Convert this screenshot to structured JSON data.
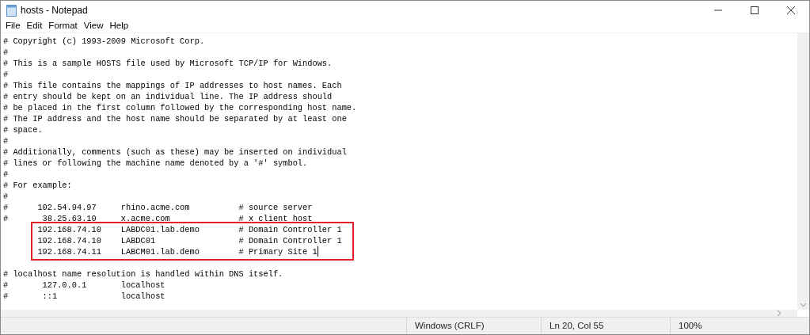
{
  "window": {
    "title": "hosts - Notepad"
  },
  "menu": [
    "File",
    "Edit",
    "Format",
    "View",
    "Help"
  ],
  "lines": [
    {
      "kind": "text",
      "text": "# Copyright (c) 1993-2009 Microsoft Corp.",
      "highlighted": false,
      "caret": false
    },
    {
      "kind": "text",
      "text": "#",
      "highlighted": false,
      "caret": false
    },
    {
      "kind": "text",
      "text": "# This is a sample HOSTS file used by Microsoft TCP/IP for Windows.",
      "highlighted": false,
      "caret": false
    },
    {
      "kind": "text",
      "text": "#",
      "highlighted": false,
      "caret": false
    },
    {
      "kind": "text",
      "text": "# This file contains the mappings of IP addresses to host names. Each",
      "highlighted": false,
      "caret": false
    },
    {
      "kind": "text",
      "text": "# entry should be kept on an individual line. The IP address should",
      "highlighted": false,
      "caret": false
    },
    {
      "kind": "text",
      "text": "# be placed in the first column followed by the corresponding host name.",
      "highlighted": false,
      "caret": false
    },
    {
      "kind": "text",
      "text": "# The IP address and the host name should be separated by at least one",
      "highlighted": false,
      "caret": false
    },
    {
      "kind": "text",
      "text": "# space.",
      "highlighted": false,
      "caret": false
    },
    {
      "kind": "text",
      "text": "#",
      "highlighted": false,
      "caret": false
    },
    {
      "kind": "text",
      "text": "# Additionally, comments (such as these) may be inserted on individual",
      "highlighted": false,
      "caret": false
    },
    {
      "kind": "text",
      "text": "# lines or following the machine name denoted by a '#' symbol.",
      "highlighted": false,
      "caret": false
    },
    {
      "kind": "text",
      "text": "#",
      "highlighted": false,
      "caret": false
    },
    {
      "kind": "text",
      "text": "# For example:",
      "highlighted": false,
      "caret": false
    },
    {
      "kind": "text",
      "text": "#",
      "highlighted": false,
      "caret": false
    },
    {
      "kind": "text",
      "text": "#      102.54.94.97     rhino.acme.com          # source server",
      "highlighted": false,
      "caret": false
    },
    {
      "kind": "text",
      "text": "#       38.25.63.10     x.acme.com              # x client host",
      "highlighted": false,
      "caret": false
    },
    {
      "kind": "text",
      "text": "       192.168.74.10    LABDC01.lab.demo        # Domain Controller 1",
      "highlighted": true,
      "caret": false
    },
    {
      "kind": "text",
      "text": "       192.168.74.10    LABDC01                 # Domain Controller 1",
      "highlighted": true,
      "caret": false
    },
    {
      "kind": "text",
      "text": "       192.168.74.11    LABCM01.lab.demo        # Primary Site 1",
      "highlighted": true,
      "caret": true
    },
    {
      "kind": "blank"
    },
    {
      "kind": "text",
      "text": "# localhost name resolution is handled within DNS itself.",
      "highlighted": false,
      "caret": false
    },
    {
      "kind": "text",
      "text": "#       127.0.0.1       localhost",
      "highlighted": false,
      "caret": false
    },
    {
      "kind": "text",
      "text": "#       ::1             localhost",
      "highlighted": false,
      "caret": false
    }
  ],
  "status_bar": {
    "line_ending": "Windows (CRLF)",
    "position": "Ln 20, Col 55",
    "zoom": "100%"
  }
}
